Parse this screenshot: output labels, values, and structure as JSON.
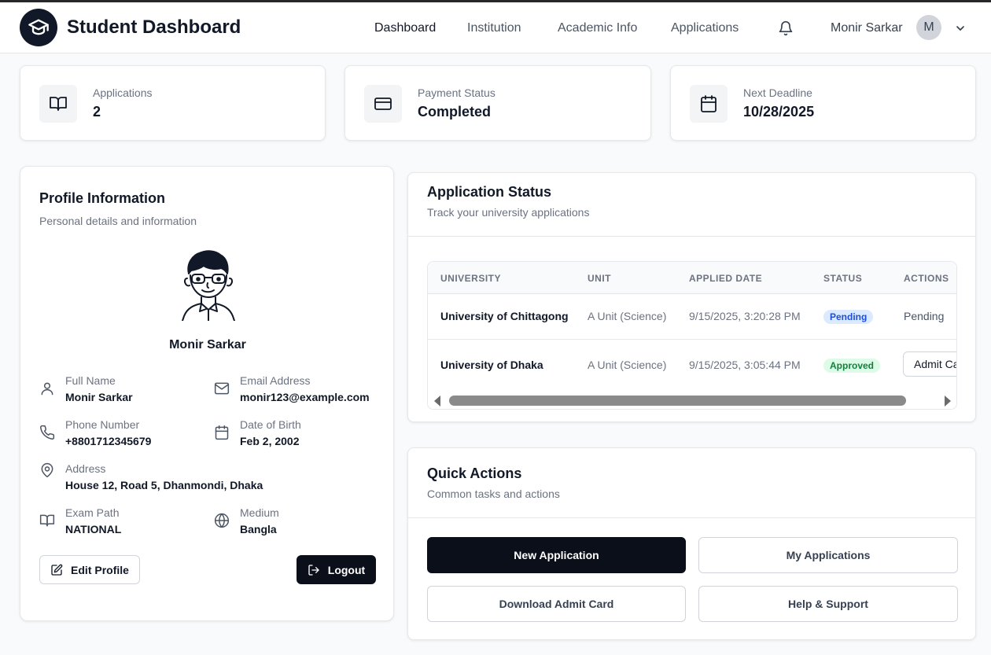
{
  "header": {
    "brand": "Student Dashboard",
    "nav": [
      "Dashboard",
      "Institution",
      "Academic Info",
      "Applications"
    ],
    "active_nav": "Dashboard",
    "user_name": "Monir Sarkar",
    "avatar_initial": "M"
  },
  "stats": [
    {
      "label": "Applications",
      "value": "2",
      "icon": "book-open-icon"
    },
    {
      "label": "Payment Status",
      "value": "Completed",
      "icon": "credit-card-icon"
    },
    {
      "label": "Next Deadline",
      "value": "10/28/2025",
      "icon": "calendar-icon"
    }
  ],
  "profile": {
    "title": "Profile Information",
    "subtitle": "Personal details and information",
    "name": "Monir Sarkar",
    "fields": {
      "full_name": {
        "label": "Full Name",
        "value": "Monir Sarkar"
      },
      "email": {
        "label": "Email Address",
        "value": "monir123@example.com"
      },
      "phone": {
        "label": "Phone Number",
        "value": "+8801712345679"
      },
      "dob": {
        "label": "Date of Birth",
        "value": "Feb 2, 2002"
      },
      "address": {
        "label": "Address",
        "value": "House 12, Road 5, Dhanmondi, Dhaka"
      },
      "exam_path": {
        "label": "Exam Path",
        "value": "NATIONAL"
      },
      "medium": {
        "label": "Medium",
        "value": "Bangla"
      }
    },
    "edit_label": "Edit Profile",
    "logout_label": "Logout"
  },
  "app_status": {
    "title": "Application Status",
    "subtitle": "Track your university applications",
    "columns": [
      "UNIVERSITY",
      "UNIT",
      "APPLIED DATE",
      "STATUS",
      "ACTIONS"
    ],
    "rows": [
      {
        "university": "University of Chittagong",
        "unit": "A Unit (Science)",
        "date": "9/15/2025, 3:20:28 PM",
        "status": "Pending",
        "action": "Pending"
      },
      {
        "university": "University of Dhaka",
        "unit": "A Unit (Science)",
        "date": "9/15/2025, 3:05:44 PM",
        "status": "Approved",
        "action": "Admit Card"
      }
    ]
  },
  "quick_actions": {
    "title": "Quick Actions",
    "subtitle": "Common tasks and actions",
    "new_application": "New Application",
    "my_applications": "My Applications",
    "download_admit": "Download Admit Card",
    "help_support": "Help & Support"
  }
}
